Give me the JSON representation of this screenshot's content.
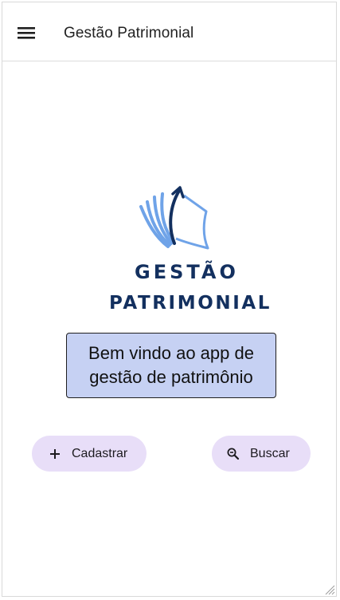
{
  "header": {
    "title": "Gestão Patrimonial",
    "menu_icon": "hamburger-menu-icon"
  },
  "logo": {
    "line1": "GESTÃO",
    "line2": "PATRIMONIAL",
    "colors": {
      "navy": "#13305f",
      "light_blue": "#6fa3e8"
    }
  },
  "welcome": {
    "text": "Bem vindo ao app de gestão de patrimônio",
    "background": "#c6d1f3"
  },
  "actions": {
    "cadastrar": {
      "label": "Cadastrar",
      "icon": "plus-icon"
    },
    "buscar": {
      "label": "Buscar",
      "icon": "search-icon"
    },
    "background": "#e8def8"
  }
}
